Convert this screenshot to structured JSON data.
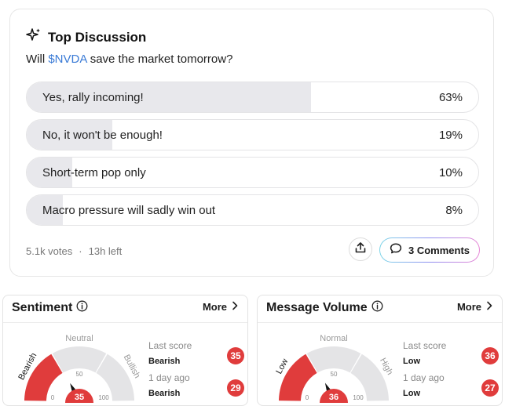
{
  "discussion": {
    "title": "Top Discussion",
    "question_prefix": "Will ",
    "ticker": "$NVDA",
    "question_suffix": " save the market tomorrow?",
    "options": [
      {
        "label": "Yes, rally incoming!",
        "percent_text": "63%",
        "percent": 63
      },
      {
        "label": "No, it won't be enough!",
        "percent_text": "19%",
        "percent": 19
      },
      {
        "label": "Short-term pop only",
        "percent_text": "10%",
        "percent": 10
      },
      {
        "label": "Macro pressure will sadly win out",
        "percent_text": "8%",
        "percent": 8
      }
    ],
    "votes": "5.1k votes",
    "separator": "·",
    "time_left": "13h left",
    "comments_label": "3 Comments"
  },
  "sentiment": {
    "title": "Sentiment",
    "more_label": "More",
    "gauge": {
      "low_label": "Bearish",
      "mid_label": "Neutral",
      "high_label": "Bullish",
      "min_tick": "0",
      "mid_tick": "50",
      "max_tick": "100",
      "value": 35,
      "value_text": "35"
    },
    "last_score_label": "Last score",
    "last_score_value": "Bearish",
    "last_score_badge": "35",
    "prev_label": "1 day ago",
    "prev_value": "Bearish",
    "prev_badge": "29"
  },
  "volume": {
    "title": "Message Volume",
    "more_label": "More",
    "gauge": {
      "low_label": "Low",
      "mid_label": "Normal",
      "high_label": "High",
      "min_tick": "0",
      "mid_tick": "50",
      "max_tick": "100",
      "value": 36,
      "value_text": "36"
    },
    "last_score_label": "Last score",
    "last_score_value": "Low",
    "last_score_badge": "36",
    "prev_label": "1 day ago",
    "prev_value": "Low",
    "prev_badge": "27"
  },
  "colors": {
    "accent_red": "#e03c3c",
    "ticker_blue": "#3b7bd6",
    "gauge_grey": "#e4e4e6",
    "option_fill": "#e8e8ec"
  },
  "icons": {
    "title": "sparkle-icon",
    "share": "share-icon",
    "comments": "comment-bubble-icon",
    "info": "info-icon",
    "more": "chevron-right-icon"
  }
}
